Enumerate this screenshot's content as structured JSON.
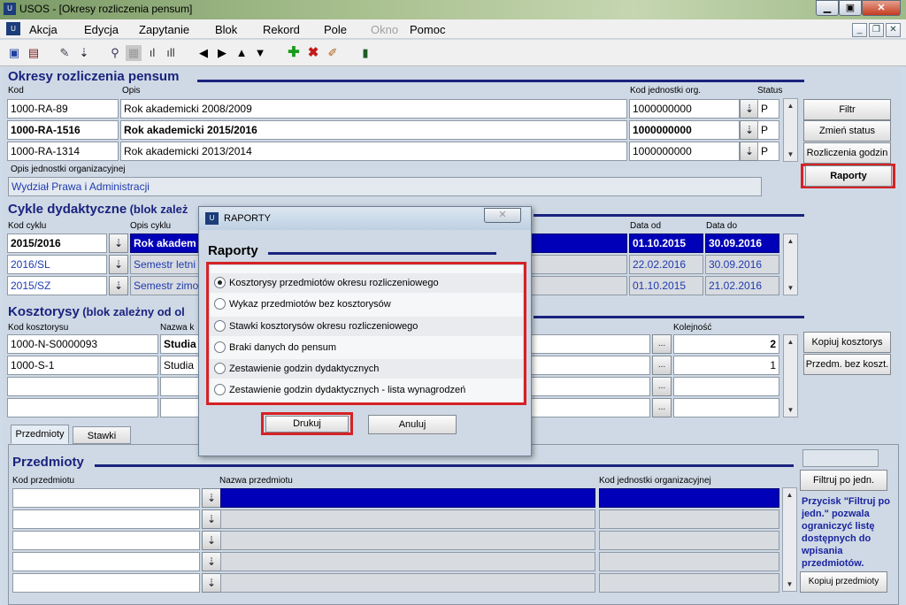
{
  "window": {
    "title": "USOS - [Okresy rozliczenia pensum]"
  },
  "menu": [
    {
      "label": "Akcja"
    },
    {
      "label": "Edycja"
    },
    {
      "label": "Zapytanie"
    },
    {
      "label": "Blok"
    },
    {
      "label": "Rekord"
    },
    {
      "label": "Pole"
    },
    {
      "label": "Okno"
    },
    {
      "label": "Pomoc"
    }
  ],
  "okresy": {
    "title": "Okresy rozliczenia pensum",
    "col_kod": "Kod",
    "col_opis": "Opis",
    "col_kod_jedn": "Kod jednostki org.",
    "col_status": "Status",
    "rows": [
      {
        "kod": "1000-RA-89",
        "opis": "Rok akademicki 2008/2009",
        "jedn": "1000000000",
        "status": "P"
      },
      {
        "kod": "1000-RA-1516",
        "opis": "Rok akademicki 2015/2016",
        "jedn": "1000000000",
        "status": "P"
      },
      {
        "kod": "1000-RA-1314",
        "opis": "Rok akademicki 2013/2014",
        "jedn": "1000000000",
        "status": "P"
      }
    ],
    "opis_jedn_label": "Opis jednostki organizacyjnej",
    "opis_jedn_value": "Wydział Prawa i Administracji",
    "buttons": {
      "filtr": "Filtr",
      "zmien": "Zmień status",
      "rozliczenia": "Rozliczenia godzin",
      "raporty": "Raporty"
    }
  },
  "cykle": {
    "title": "Cykle dydaktyczne",
    "subtitle": "(blok zależ",
    "col_kod": "Kod cyklu",
    "col_opis": "Opis cyklu",
    "col_od": "Data od",
    "col_do": "Data do",
    "rows": [
      {
        "kod": "2015/2016",
        "opis": "Rok akadem",
        "od": "01.10.2015",
        "do": "30.09.2016"
      },
      {
        "kod": "2016/SL",
        "opis": "Semestr letni",
        "od": "22.02.2016",
        "do": "30.09.2016"
      },
      {
        "kod": "2015/SZ",
        "opis": "Semestr zimo",
        "od": "01.10.2015",
        "do": "21.02.2016"
      }
    ]
  },
  "kosztorysy": {
    "title": "Kosztorysy",
    "subtitle": "(blok zależny od ol",
    "col_kod": "Kod kosztorysu",
    "col_nazwa": "Nazwa k",
    "col_kolejnosc": "Kolejność",
    "rows": [
      {
        "kod": "1000-N-S0000093",
        "nazwa": "Studia",
        "kolejnosc": "2"
      },
      {
        "kod": "1000-S-1",
        "nazwa": "Studia",
        "kolejnosc": "1"
      },
      {
        "kod": "",
        "nazwa": "",
        "kolejnosc": ""
      },
      {
        "kod": "",
        "nazwa": "",
        "kolejnosc": ""
      }
    ],
    "buttons": {
      "kopiuj": "Kopiuj kosztorys",
      "przedm": "Przedm. bez koszt."
    }
  },
  "tabs": [
    {
      "label": "Przedmioty"
    },
    {
      "label": "Stawki"
    }
  ],
  "przedmioty": {
    "title": "Przedmioty",
    "col_kod": "Kod przedmiotu",
    "col_nazwa": "Nazwa przedmiotu",
    "col_jedn": "Kod jednostki organizacyjnej",
    "filtr_btn": "Filtruj po jedn.",
    "hint": "Przycisk \"Filtruj po jedn.\" pozwala ograniczyć listę dostępnych do wpisania przedmiotów.",
    "kopiuj_btn": "Kopiuj przedmioty"
  },
  "dialog": {
    "title": "RAPORTY",
    "heading": "Raporty",
    "options": [
      {
        "label": "Kosztorysy przedmiotów okresu rozliczeniowego",
        "selected": true
      },
      {
        "label": "Wykaz przedmiotów bez kosztorysów",
        "selected": false
      },
      {
        "label": "Stawki kosztorysów okresu rozliczeniowego",
        "selected": false
      },
      {
        "label": "Braki danych do pensum",
        "selected": false
      },
      {
        "label": "Zestawienie godzin dydaktycznych",
        "selected": false
      },
      {
        "label": "Zestawienie godzin dydaktycznych - lista wynagrodzeń",
        "selected": false
      }
    ],
    "print_btn": "Drukuj",
    "cancel_btn": "Anuluj"
  },
  "colors": {
    "accent": "#1a237e",
    "selection": "#0000b8",
    "highlight": "#d52225"
  }
}
